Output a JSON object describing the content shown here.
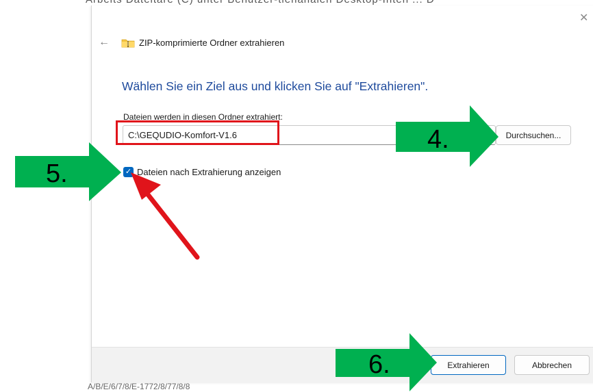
{
  "background": {
    "top_text": "Arbeits Dateitäre (C) unter Benutzer-tienanalen  Desktop-Inten  ...  D",
    "bottom_text": "A/B/E/6/7/8/E-1772/8/77/8/8"
  },
  "dialog": {
    "title": "ZIP-komprimierte Ordner extrahieren",
    "heading": "Wählen Sie ein Ziel aus und klicken Sie auf \"Extrahieren\".",
    "folder_label": "Dateien werden in diesen Ordner extrahiert:",
    "path_value": "C:\\GEQUDIO-Komfort-V1.6",
    "browse_label": "Durchsuchen...",
    "checkbox_label": "Dateien nach Extrahierung anzeigen",
    "checkbox_checked": true,
    "extract_label": "Extrahieren",
    "cancel_label": "Abbrechen"
  },
  "icons": {
    "back": "back-arrow-icon",
    "close": "close-icon",
    "folder": "zip-folder-icon",
    "check": "checkmark-icon"
  },
  "annotations": {
    "step4": "4.",
    "step5": "5.",
    "step6": "6."
  },
  "colors": {
    "arrow_green": "#00b050",
    "highlight_red": "#e0141b",
    "heading_blue": "#1e4a9c",
    "checkbox_blue": "#0067c0"
  }
}
